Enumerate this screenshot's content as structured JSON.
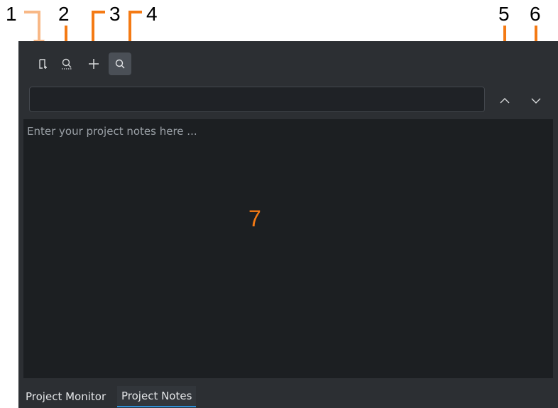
{
  "annotations": {
    "n1": "1",
    "n2": "2",
    "n3": "3",
    "n4": "4",
    "n5": "5",
    "n6": "6",
    "n7": "7"
  },
  "toolbar": {
    "icons": [
      "bookmark-add-icon",
      "find-all-icon",
      "add-icon",
      "search-icon"
    ],
    "active": "search-icon"
  },
  "search": {
    "value": "",
    "placeholder": ""
  },
  "nav": {
    "up_icon": "chevron-up-icon",
    "down_icon": "chevron-down-icon"
  },
  "notes": {
    "placeholder": "Enter your project notes here ..."
  },
  "tabs": [
    {
      "label": "Project Monitor",
      "active": false
    },
    {
      "label": "Project Notes",
      "active": true
    }
  ],
  "colors": {
    "panel": "#2c2f33",
    "editor": "#1c1f22",
    "accent_orange": "#f47a14",
    "tab_underline": "#2f8fd6"
  }
}
